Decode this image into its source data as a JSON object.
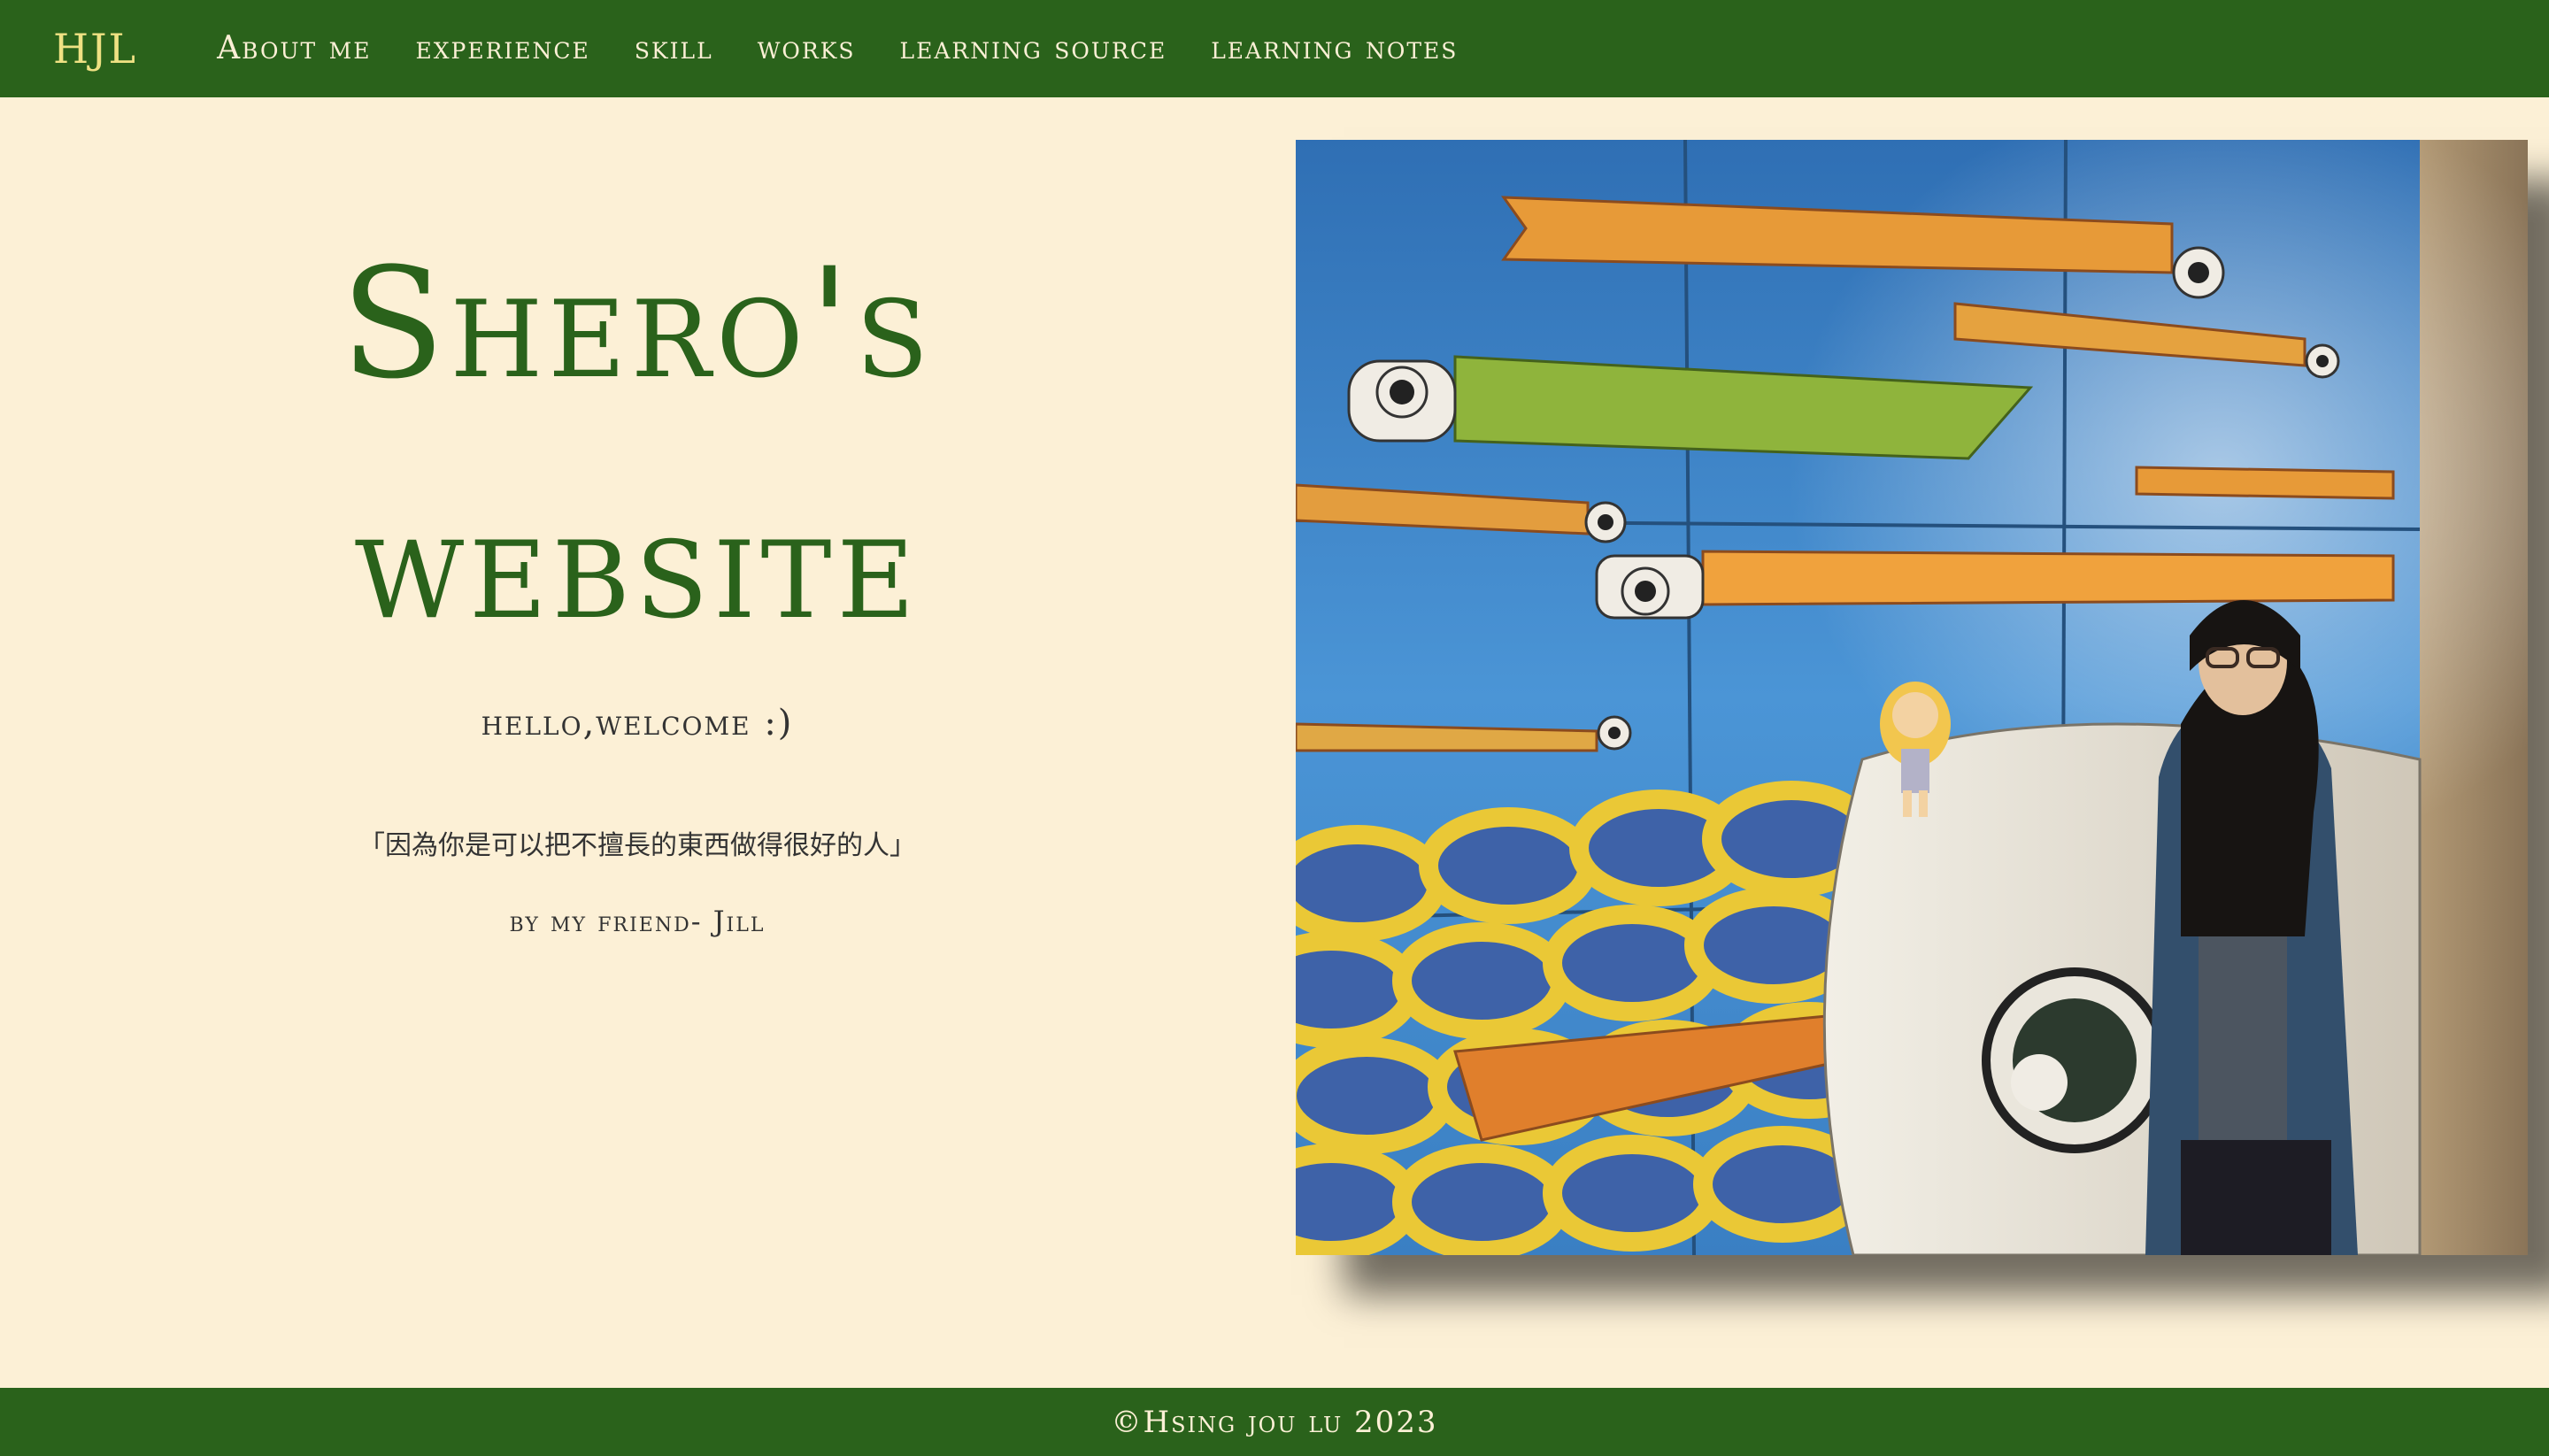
{
  "navbar": {
    "brand": "HJL",
    "items": [
      {
        "label": "About me"
      },
      {
        "label": "experience"
      },
      {
        "label": "skill"
      },
      {
        "label": "works"
      },
      {
        "label": "learning source"
      },
      {
        "label": "learning notes"
      }
    ]
  },
  "hero": {
    "title_line1": "Shero's",
    "title_line2": "website",
    "welcome": "hello,welcome :)",
    "quote": "「因為你是可以把不擅長的東西做得很好的人」",
    "byline": "by my friend- Jill"
  },
  "footer": {
    "copyright": "©Hsing jou lu 2023"
  },
  "colors": {
    "primary_green": "#2a621b",
    "background_cream": "#fcf0d6",
    "brand_yellow": "#efe183"
  }
}
